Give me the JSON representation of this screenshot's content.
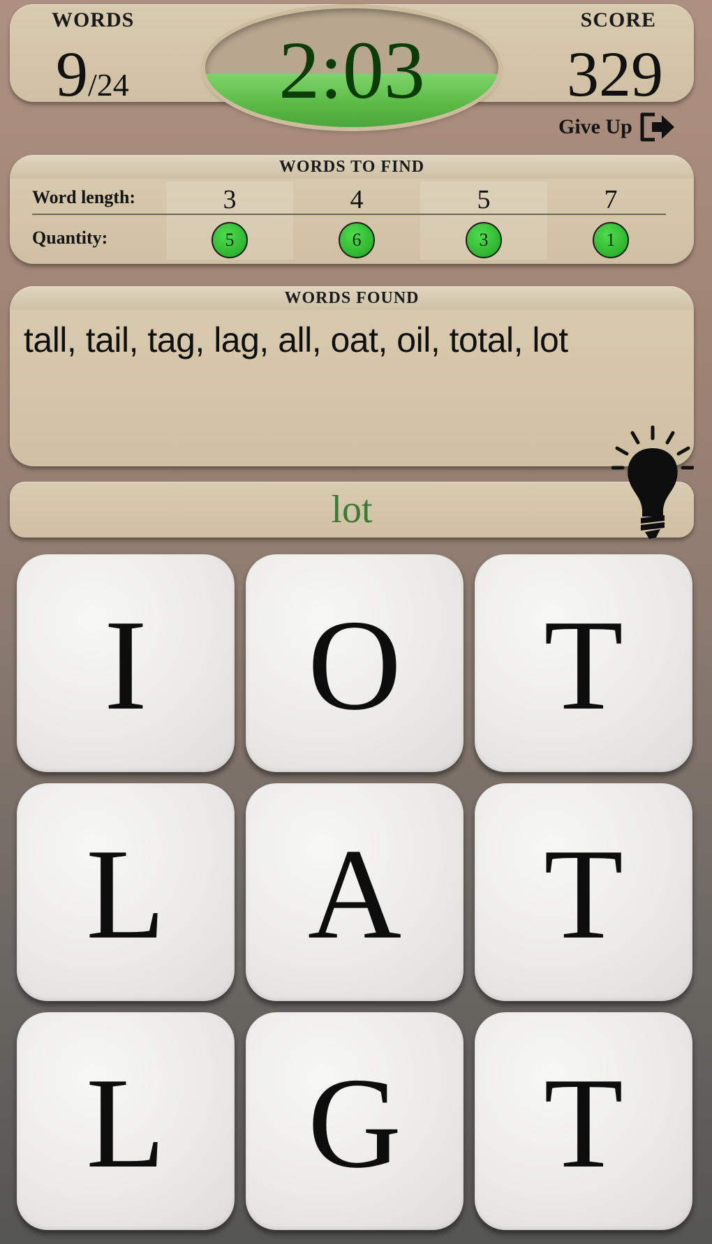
{
  "top_bar": {
    "words_label": "WORDS",
    "words_found": "9",
    "words_total": "/24",
    "score_label": "SCORE",
    "score_value": "329",
    "timer_text": "2:03",
    "timer_remaining_fraction": 0.45,
    "give_up_label": "Give Up",
    "give_up_icon": "exit-arrow-icon"
  },
  "words_to_find": {
    "title": "WORDS TO FIND",
    "length_label": "Word length:",
    "quantity_label": "Quantity:",
    "columns": [
      {
        "length": "3",
        "quantity": "5"
      },
      {
        "length": "4",
        "quantity": "6"
      },
      {
        "length": "5",
        "quantity": "3"
      },
      {
        "length": "7",
        "quantity": "1"
      }
    ]
  },
  "words_found": {
    "title": "WORDS FOUND",
    "list": "tall, tail, tag, lag, all, oat, oil, total, lot"
  },
  "current_word": "lot",
  "hint_icon": "lightbulb-icon",
  "grid": [
    "I",
    "O",
    "T",
    "L",
    "A",
    "T",
    "L",
    "G",
    "T"
  ],
  "colors": {
    "timer_green": "#5cbb47",
    "quantity_green": "#2fb42f",
    "current_word_text": "#3a7a36",
    "panel_bg": "#d4c5a9"
  }
}
